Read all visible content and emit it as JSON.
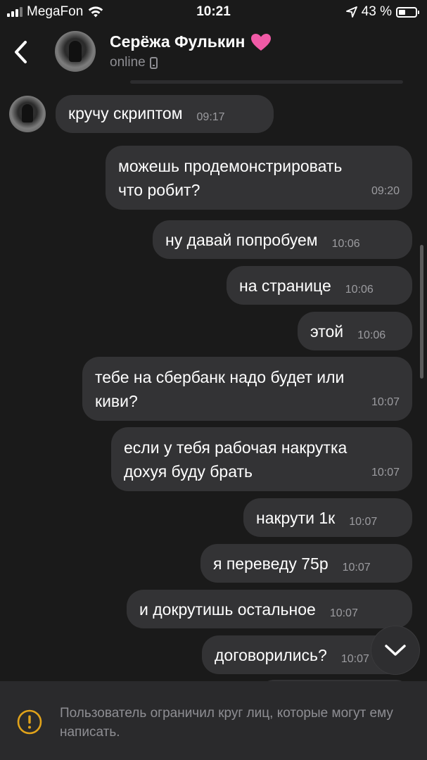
{
  "status_bar": {
    "carrier": "MegaFon",
    "time": "10:21",
    "battery": "43 %",
    "battery_level": 0.43
  },
  "header": {
    "name": "Серёжа Фулькин",
    "status": "online"
  },
  "messages": [
    {
      "side": "in",
      "text": "кручу скриптом",
      "time": "09:17"
    },
    {
      "side": "out",
      "text": "можешь продемонстрировать\nчто робит?",
      "time": "09:20"
    },
    {
      "side": "out",
      "text": "ну давай попробуем",
      "time": "10:06"
    },
    {
      "side": "out",
      "text": "на странице",
      "time": "10:06"
    },
    {
      "side": "out",
      "text": "этой",
      "time": "10:06"
    },
    {
      "side": "out",
      "text": "тебе на сбербанк надо будет или\nкиви?",
      "time": "10:07"
    },
    {
      "side": "out",
      "text": "если у тебя рабочая накрутка\nдохуя буду брать",
      "time": "10:07"
    },
    {
      "side": "out",
      "text": "накрути 1к",
      "time": "10:07"
    },
    {
      "side": "out",
      "text": "я переведу 75р",
      "time": "10:07"
    },
    {
      "side": "out",
      "text": "и докрутишь остальное",
      "time": "10:07"
    },
    {
      "side": "out",
      "text": "договорились?",
      "time": "10:07"
    }
  ],
  "footer": {
    "notice": "Пользователь ограничил круг лиц, которые могут ему написать."
  },
  "colors": {
    "background": "#1a1a1a",
    "bubble": "#333335",
    "footer": "#2a2a2c",
    "warning": "#e0a21a",
    "heart": "#f05aa6"
  },
  "icons": [
    "back-icon",
    "heart-icon",
    "phone-icon",
    "chevron-down-icon",
    "warning-icon",
    "wifi-icon",
    "location-arrow-icon",
    "battery-icon",
    "signal-icon"
  ]
}
